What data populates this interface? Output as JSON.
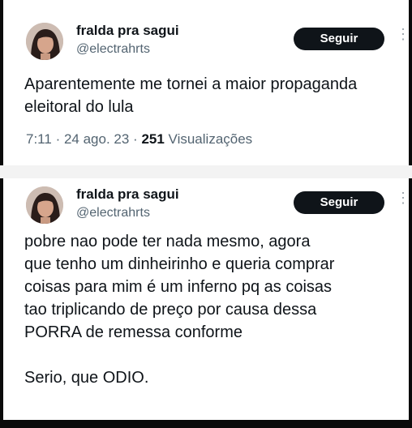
{
  "tweets": [
    {
      "name": "fralda pra sagui",
      "handle": "@electrahrts",
      "follow_label": "Seguir",
      "more_glyph": "⋮",
      "text": "Aparentemente me tornei a maior propaganda eleitoral do lula",
      "time": "7:11",
      "date": "24 ago. 23",
      "views_count": "251",
      "views_label": "Visualizações"
    },
    {
      "name": "fralda pra sagui",
      "handle": "@electrahrts",
      "follow_label": "Seguir",
      "more_glyph": "⋮",
      "text_lines": [
        "pobre nao pode ter nada mesmo, agora",
        "que tenho um dinheirinho e queria comprar",
        "coisas para mim é um inferno pq as coisas",
        "tao triplicando de preço por causa dessa",
        "PORRA de remessa conforme"
      ],
      "text_last": "Serio, que ODIO."
    }
  ],
  "colors": {
    "button_bg": "#0f1419",
    "secondary_text": "#536471"
  }
}
